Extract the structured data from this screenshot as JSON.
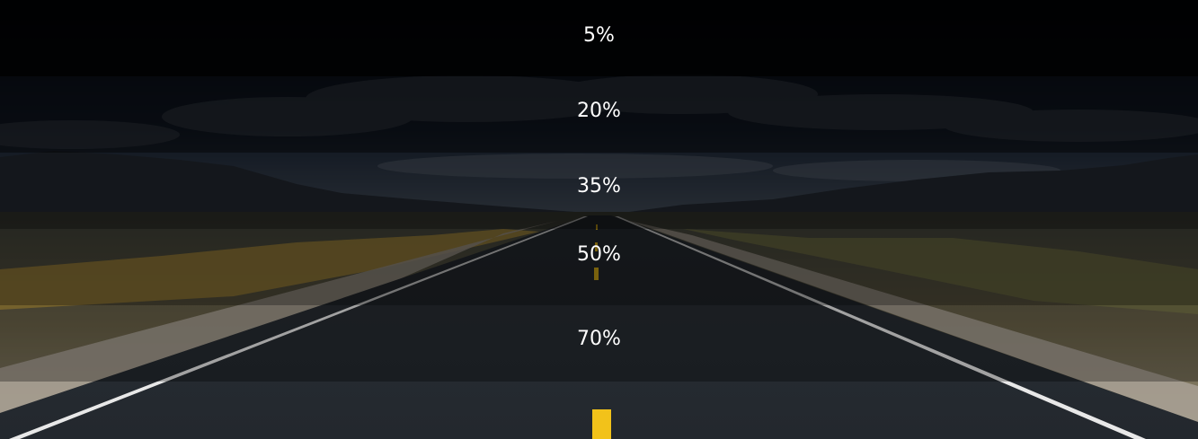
{
  "bands": [
    {
      "label": "5%"
    },
    {
      "label": "20%"
    },
    {
      "label": "35%"
    },
    {
      "label": "50%"
    },
    {
      "label": "70%"
    }
  ],
  "colors": {
    "sky": "#1b2a44",
    "asphalt": "#1c2024",
    "edge_line": "#e8e8e8",
    "center_line": "#f2c21a",
    "grass": "#b8963e"
  }
}
